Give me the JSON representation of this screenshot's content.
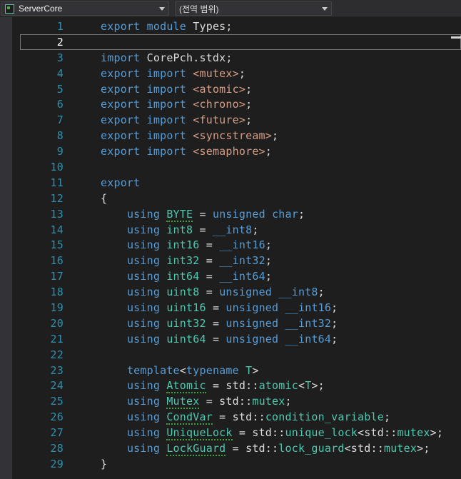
{
  "navbar": {
    "project": "ServerCore",
    "scope": "(전역 범위)"
  },
  "colors": {
    "keyword": "#569CD6",
    "type": "#4EC9B0",
    "string": "#D69D85",
    "line_number": "#2B91AF",
    "current_line_number": "#FFFFFF",
    "background": "#1E1E1E",
    "squiggle": "#3BA33B"
  },
  "editor": {
    "language": "cpp-module",
    "lines": [
      {
        "num": "1",
        "tokens": [
          {
            "t": "export",
            "c": "kw"
          },
          {
            "t": " ",
            "c": "plain"
          },
          {
            "t": "module",
            "c": "kw"
          },
          {
            "t": " Types;",
            "c": "plain"
          }
        ]
      },
      {
        "num": "2",
        "current": true,
        "tokens": []
      },
      {
        "num": "3",
        "tokens": [
          {
            "t": "import",
            "c": "kw"
          },
          {
            "t": " CorePch.stdx;",
            "c": "plain"
          }
        ]
      },
      {
        "num": "4",
        "tokens": [
          {
            "t": "export",
            "c": "kw"
          },
          {
            "t": " ",
            "c": "plain"
          },
          {
            "t": "import",
            "c": "kw"
          },
          {
            "t": " ",
            "c": "plain"
          },
          {
            "t": "<mutex>",
            "c": "str"
          },
          {
            "t": ";",
            "c": "plain"
          }
        ]
      },
      {
        "num": "5",
        "tokens": [
          {
            "t": "export",
            "c": "kw"
          },
          {
            "t": " ",
            "c": "plain"
          },
          {
            "t": "import",
            "c": "kw"
          },
          {
            "t": " ",
            "c": "plain"
          },
          {
            "t": "<atomic>",
            "c": "str"
          },
          {
            "t": ";",
            "c": "plain"
          }
        ]
      },
      {
        "num": "6",
        "tokens": [
          {
            "t": "export",
            "c": "kw"
          },
          {
            "t": " ",
            "c": "plain"
          },
          {
            "t": "import",
            "c": "kw"
          },
          {
            "t": " ",
            "c": "plain"
          },
          {
            "t": "<chrono>",
            "c": "str"
          },
          {
            "t": ";",
            "c": "plain"
          }
        ]
      },
      {
        "num": "7",
        "tokens": [
          {
            "t": "export",
            "c": "kw"
          },
          {
            "t": " ",
            "c": "plain"
          },
          {
            "t": "import",
            "c": "kw"
          },
          {
            "t": " ",
            "c": "plain"
          },
          {
            "t": "<future>",
            "c": "str"
          },
          {
            "t": ";",
            "c": "plain"
          }
        ]
      },
      {
        "num": "8",
        "tokens": [
          {
            "t": "export",
            "c": "kw"
          },
          {
            "t": " ",
            "c": "plain"
          },
          {
            "t": "import",
            "c": "kw"
          },
          {
            "t": " ",
            "c": "plain"
          },
          {
            "t": "<syncstream>",
            "c": "str"
          },
          {
            "t": ";",
            "c": "plain"
          }
        ]
      },
      {
        "num": "9",
        "tokens": [
          {
            "t": "export",
            "c": "kw"
          },
          {
            "t": " ",
            "c": "plain"
          },
          {
            "t": "import",
            "c": "kw"
          },
          {
            "t": " ",
            "c": "plain"
          },
          {
            "t": "<semaphore>",
            "c": "str"
          },
          {
            "t": ";",
            "c": "plain"
          }
        ]
      },
      {
        "num": "10",
        "tokens": []
      },
      {
        "num": "11",
        "tokens": [
          {
            "t": "export",
            "c": "kw"
          }
        ]
      },
      {
        "num": "12",
        "tokens": [
          {
            "t": "{",
            "c": "plain"
          }
        ]
      },
      {
        "num": "13",
        "tokens": [
          {
            "t": "    ",
            "c": "plain"
          },
          {
            "t": "using",
            "c": "kw"
          },
          {
            "t": " ",
            "c": "plain"
          },
          {
            "t": "BYTE",
            "c": "type",
            "u": true
          },
          {
            "t": " = ",
            "c": "plain"
          },
          {
            "t": "unsigned",
            "c": "kw"
          },
          {
            "t": " ",
            "c": "plain"
          },
          {
            "t": "char",
            "c": "kw"
          },
          {
            "t": ";",
            "c": "plain"
          }
        ]
      },
      {
        "num": "14",
        "tokens": [
          {
            "t": "    ",
            "c": "plain"
          },
          {
            "t": "using",
            "c": "kw"
          },
          {
            "t": " ",
            "c": "plain"
          },
          {
            "t": "int8",
            "c": "type"
          },
          {
            "t": " = ",
            "c": "plain"
          },
          {
            "t": "__int8",
            "c": "kw"
          },
          {
            "t": ";",
            "c": "plain"
          }
        ]
      },
      {
        "num": "15",
        "tokens": [
          {
            "t": "    ",
            "c": "plain"
          },
          {
            "t": "using",
            "c": "kw"
          },
          {
            "t": " ",
            "c": "plain"
          },
          {
            "t": "int16",
            "c": "type"
          },
          {
            "t": " = ",
            "c": "plain"
          },
          {
            "t": "__int16",
            "c": "kw"
          },
          {
            "t": ";",
            "c": "plain"
          }
        ]
      },
      {
        "num": "16",
        "tokens": [
          {
            "t": "    ",
            "c": "plain"
          },
          {
            "t": "using",
            "c": "kw"
          },
          {
            "t": " ",
            "c": "plain"
          },
          {
            "t": "int32",
            "c": "type"
          },
          {
            "t": " = ",
            "c": "plain"
          },
          {
            "t": "__int32",
            "c": "kw"
          },
          {
            "t": ";",
            "c": "plain"
          }
        ]
      },
      {
        "num": "17",
        "tokens": [
          {
            "t": "    ",
            "c": "plain"
          },
          {
            "t": "using",
            "c": "kw"
          },
          {
            "t": " ",
            "c": "plain"
          },
          {
            "t": "int64",
            "c": "type"
          },
          {
            "t": " = ",
            "c": "plain"
          },
          {
            "t": "__int64",
            "c": "kw"
          },
          {
            "t": ";",
            "c": "plain"
          }
        ]
      },
      {
        "num": "18",
        "tokens": [
          {
            "t": "    ",
            "c": "plain"
          },
          {
            "t": "using",
            "c": "kw"
          },
          {
            "t": " ",
            "c": "plain"
          },
          {
            "t": "uint8",
            "c": "type"
          },
          {
            "t": " = ",
            "c": "plain"
          },
          {
            "t": "unsigned",
            "c": "kw"
          },
          {
            "t": " ",
            "c": "plain"
          },
          {
            "t": "__int8",
            "c": "kw"
          },
          {
            "t": ";",
            "c": "plain"
          }
        ]
      },
      {
        "num": "19",
        "tokens": [
          {
            "t": "    ",
            "c": "plain"
          },
          {
            "t": "using",
            "c": "kw"
          },
          {
            "t": " ",
            "c": "plain"
          },
          {
            "t": "uint16",
            "c": "type"
          },
          {
            "t": " = ",
            "c": "plain"
          },
          {
            "t": "unsigned",
            "c": "kw"
          },
          {
            "t": " ",
            "c": "plain"
          },
          {
            "t": "__int16",
            "c": "kw"
          },
          {
            "t": ";",
            "c": "plain"
          }
        ]
      },
      {
        "num": "20",
        "tokens": [
          {
            "t": "    ",
            "c": "plain"
          },
          {
            "t": "using",
            "c": "kw"
          },
          {
            "t": " ",
            "c": "plain"
          },
          {
            "t": "uint32",
            "c": "type"
          },
          {
            "t": " = ",
            "c": "plain"
          },
          {
            "t": "unsigned",
            "c": "kw"
          },
          {
            "t": " ",
            "c": "plain"
          },
          {
            "t": "__int32",
            "c": "kw"
          },
          {
            "t": ";",
            "c": "plain"
          }
        ]
      },
      {
        "num": "21",
        "tokens": [
          {
            "t": "    ",
            "c": "plain"
          },
          {
            "t": "using",
            "c": "kw"
          },
          {
            "t": " ",
            "c": "plain"
          },
          {
            "t": "uint64",
            "c": "type"
          },
          {
            "t": " = ",
            "c": "plain"
          },
          {
            "t": "unsigned",
            "c": "kw"
          },
          {
            "t": " ",
            "c": "plain"
          },
          {
            "t": "__int64",
            "c": "kw"
          },
          {
            "t": ";",
            "c": "plain"
          }
        ]
      },
      {
        "num": "22",
        "tokens": []
      },
      {
        "num": "23",
        "tokens": [
          {
            "t": "    ",
            "c": "plain"
          },
          {
            "t": "template",
            "c": "kw"
          },
          {
            "t": "<",
            "c": "plain"
          },
          {
            "t": "typename",
            "c": "kw"
          },
          {
            "t": " ",
            "c": "plain"
          },
          {
            "t": "T",
            "c": "type"
          },
          {
            "t": ">",
            "c": "plain"
          }
        ]
      },
      {
        "num": "24",
        "tokens": [
          {
            "t": "    ",
            "c": "plain"
          },
          {
            "t": "using",
            "c": "kw"
          },
          {
            "t": " ",
            "c": "plain"
          },
          {
            "t": "Atomic",
            "c": "type",
            "u": true
          },
          {
            "t": " = std::",
            "c": "plain"
          },
          {
            "t": "atomic",
            "c": "type"
          },
          {
            "t": "<",
            "c": "plain"
          },
          {
            "t": "T",
            "c": "type"
          },
          {
            "t": ">;",
            "c": "plain"
          }
        ]
      },
      {
        "num": "25",
        "tokens": [
          {
            "t": "    ",
            "c": "plain"
          },
          {
            "t": "using",
            "c": "kw"
          },
          {
            "t": " ",
            "c": "plain"
          },
          {
            "t": "Mutex",
            "c": "type",
            "u": true
          },
          {
            "t": " = std::",
            "c": "plain"
          },
          {
            "t": "mutex",
            "c": "type"
          },
          {
            "t": ";",
            "c": "plain"
          }
        ]
      },
      {
        "num": "26",
        "tokens": [
          {
            "t": "    ",
            "c": "plain"
          },
          {
            "t": "using",
            "c": "kw"
          },
          {
            "t": " ",
            "c": "plain"
          },
          {
            "t": "CondVar",
            "c": "type",
            "u": true
          },
          {
            "t": " = std::",
            "c": "plain"
          },
          {
            "t": "condition_variable",
            "c": "type"
          },
          {
            "t": ";",
            "c": "plain"
          }
        ]
      },
      {
        "num": "27",
        "tokens": [
          {
            "t": "    ",
            "c": "plain"
          },
          {
            "t": "using",
            "c": "kw"
          },
          {
            "t": " ",
            "c": "plain"
          },
          {
            "t": "UniqueLock",
            "c": "type",
            "u": true
          },
          {
            "t": " = std::",
            "c": "plain"
          },
          {
            "t": "unique_lock",
            "c": "type"
          },
          {
            "t": "<std::",
            "c": "plain"
          },
          {
            "t": "mutex",
            "c": "type"
          },
          {
            "t": ">;",
            "c": "plain"
          }
        ]
      },
      {
        "num": "28",
        "tokens": [
          {
            "t": "    ",
            "c": "plain"
          },
          {
            "t": "using",
            "c": "kw"
          },
          {
            "t": " ",
            "c": "plain"
          },
          {
            "t": "LockGuard",
            "c": "type",
            "u": true
          },
          {
            "t": " = std::",
            "c": "plain"
          },
          {
            "t": "lock_guard",
            "c": "type"
          },
          {
            "t": "<std::",
            "c": "plain"
          },
          {
            "t": "mutex",
            "c": "type"
          },
          {
            "t": ">;",
            "c": "plain"
          }
        ]
      },
      {
        "num": "29",
        "tokens": [
          {
            "t": "}",
            "c": "plain"
          }
        ]
      }
    ]
  }
}
